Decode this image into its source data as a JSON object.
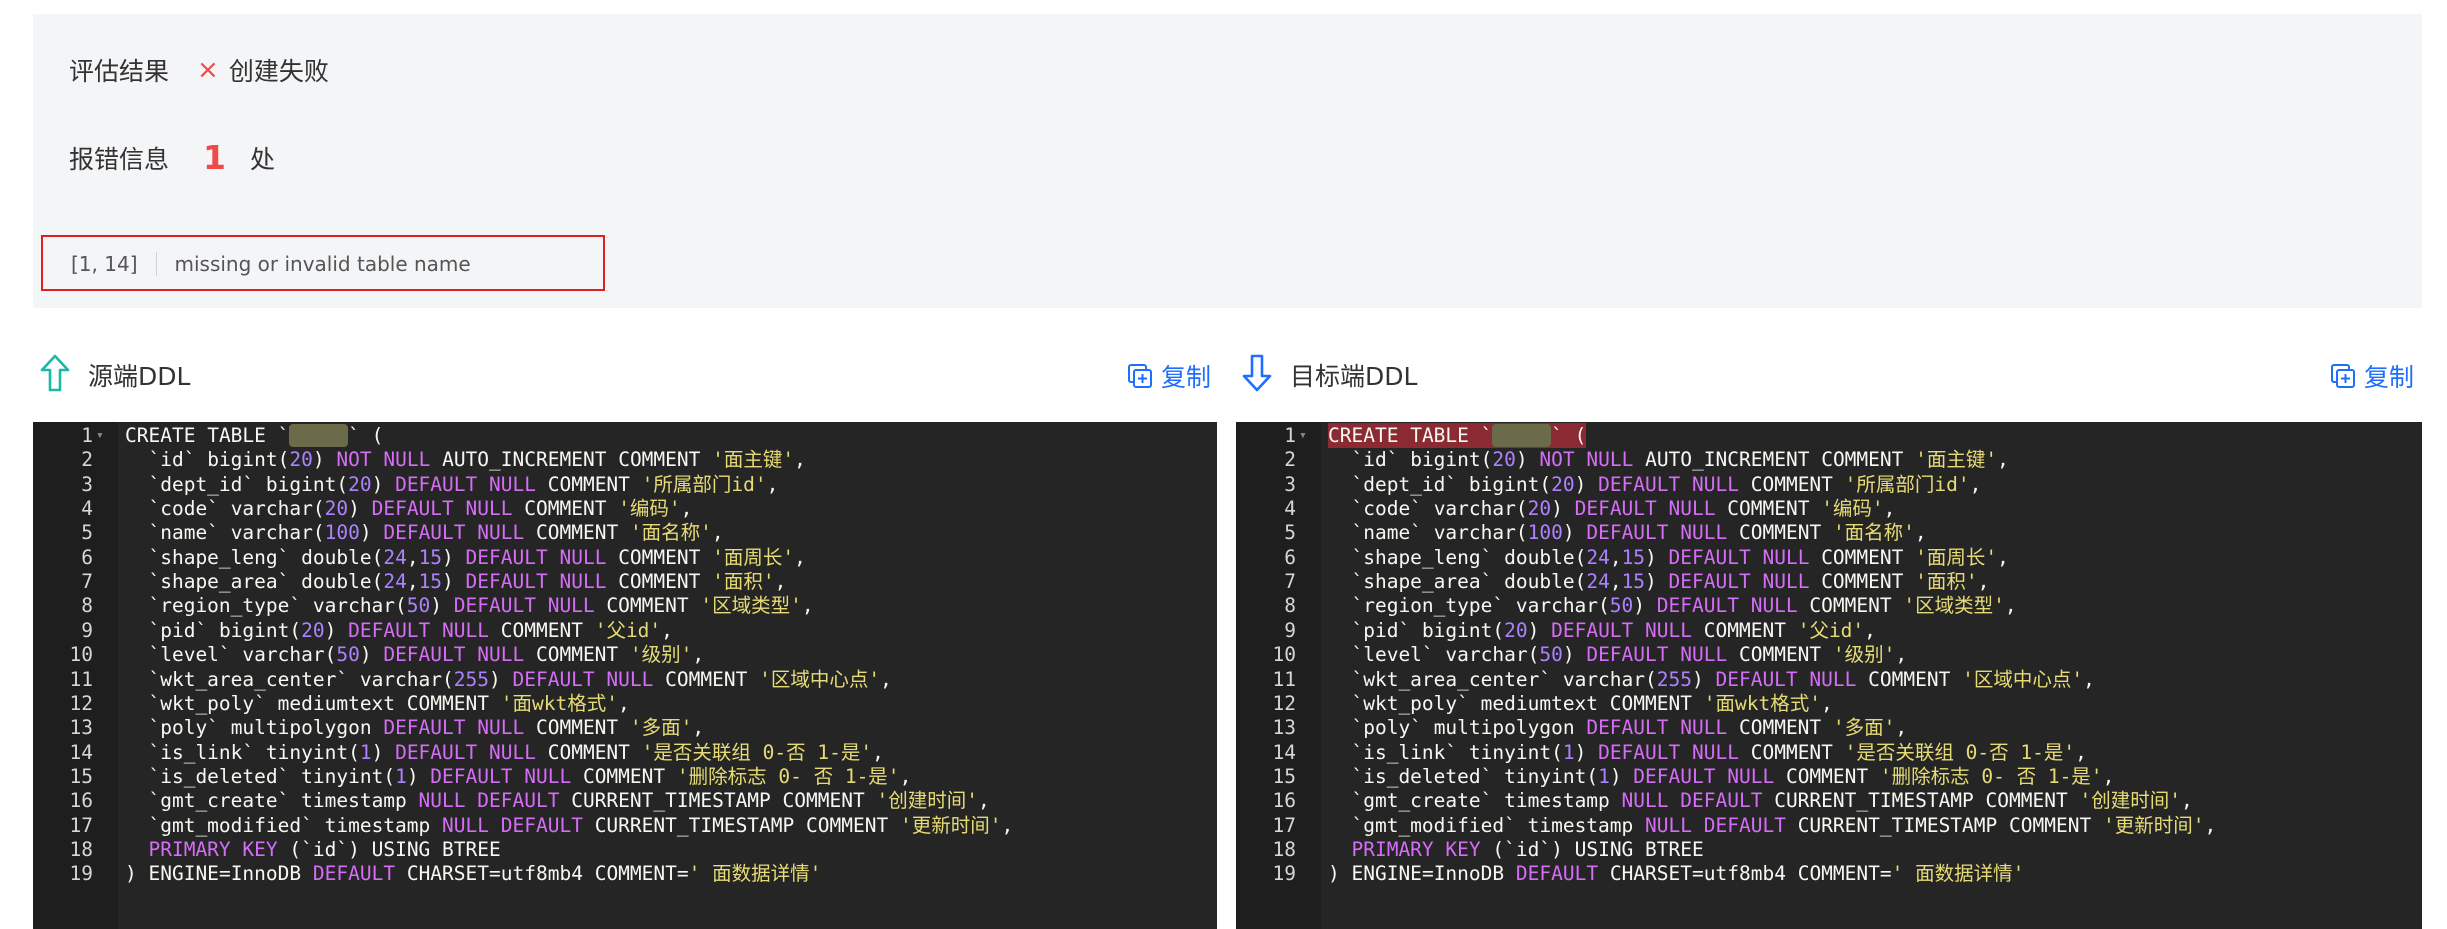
{
  "result": {
    "label": "评估结果",
    "status_icon": "×",
    "status_text": "创建失败"
  },
  "errors": {
    "label": "报错信息",
    "count": "1",
    "unit": "处",
    "items": [
      {
        "position": "[1, 14]",
        "message": "missing or invalid table name"
      }
    ]
  },
  "source": {
    "title": "源端DDL",
    "copy_label": "复制",
    "icon": "arrow-up-icon"
  },
  "target": {
    "title": "目标端DDL",
    "copy_label": "复制",
    "icon": "arrow-down-icon"
  },
  "colors": {
    "accent": "#1e6fff",
    "error": "#f0494a",
    "editor_bg": "#252526",
    "string": "#e6db74",
    "number": "#ae81ff",
    "keyword": "#d56df6"
  },
  "code_lines": [
    "CREATE TABLE `     ` (",
    "  `id` bigint(20) NOT NULL AUTO_INCREMENT COMMENT '面主键',",
    "  `dept_id` bigint(20) DEFAULT NULL COMMENT '所属部门id',",
    "  `code` varchar(20) DEFAULT NULL COMMENT '编码',",
    "  `name` varchar(100) DEFAULT NULL COMMENT '面名称',",
    "  `shape_leng` double(24,15) DEFAULT NULL COMMENT '面周长',",
    "  `shape_area` double(24,15) DEFAULT NULL COMMENT '面积',",
    "  `region_type` varchar(50) DEFAULT NULL COMMENT '区域类型',",
    "  `pid` bigint(20) DEFAULT NULL COMMENT '父id',",
    "  `level` varchar(50) DEFAULT NULL COMMENT '级别',",
    "  `wkt_area_center` varchar(255) DEFAULT NULL COMMENT '区域中心点',",
    "  `wkt_poly` mediumtext COMMENT '面wkt格式',",
    "  `poly` multipolygon DEFAULT NULL COMMENT '多面',",
    "  `is_link` tinyint(1) DEFAULT NULL COMMENT '是否关联组 0-否 1-是',",
    "  `is_deleted` tinyint(1) DEFAULT NULL COMMENT '删除标志 0- 否 1-是',",
    "  `gmt_create` timestamp NULL DEFAULT CURRENT_TIMESTAMP COMMENT '创建时间',",
    "  `gmt_modified` timestamp NULL DEFAULT CURRENT_TIMESTAMP COMMENT '更新时间',",
    "  PRIMARY KEY (`id`) USING BTREE",
    ") ENGINE=InnoDB DEFAULT CHARSET=utf8mb4 COMMENT=' 面数据详情'"
  ]
}
